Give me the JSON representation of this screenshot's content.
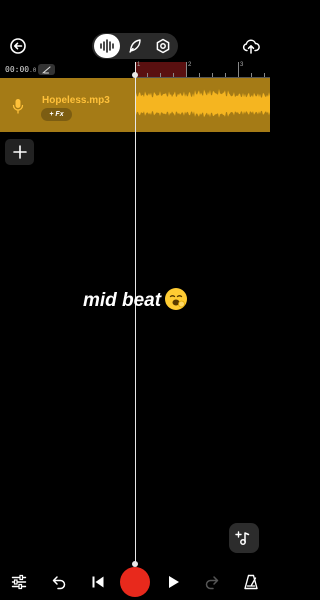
{
  "top_bar": {
    "icons": {
      "back": "back-icon",
      "waveform": "waveform-icon",
      "feather": "feather-icon",
      "settings": "settings-icon",
      "upload": "upload-cloud-icon"
    }
  },
  "ruler": {
    "time": "00:00",
    "time_fraction": ".0",
    "ticks": [
      "1",
      "2",
      "3"
    ],
    "metronome_icon": "metronome-icon"
  },
  "track": {
    "name": "Hopeless.mp3",
    "fx_label": "+ Fx",
    "color": "#a57b16",
    "name_color": "#ffc13a",
    "waveform_color": "#f5b520",
    "icon": "microphone-icon"
  },
  "add_track_icon": "plus-icon",
  "caption": {
    "text": "mid beat",
    "emoji_icon": "yawning-face-emoji"
  },
  "add_note_icon": "add-note-icon",
  "bottom_bar": {
    "icons": [
      "mixer-icon",
      "undo-icon",
      "skip-back-icon",
      "record-icon",
      "play-icon",
      "redo-icon",
      "metronome-icon"
    ],
    "record_color": "#e8291c"
  }
}
